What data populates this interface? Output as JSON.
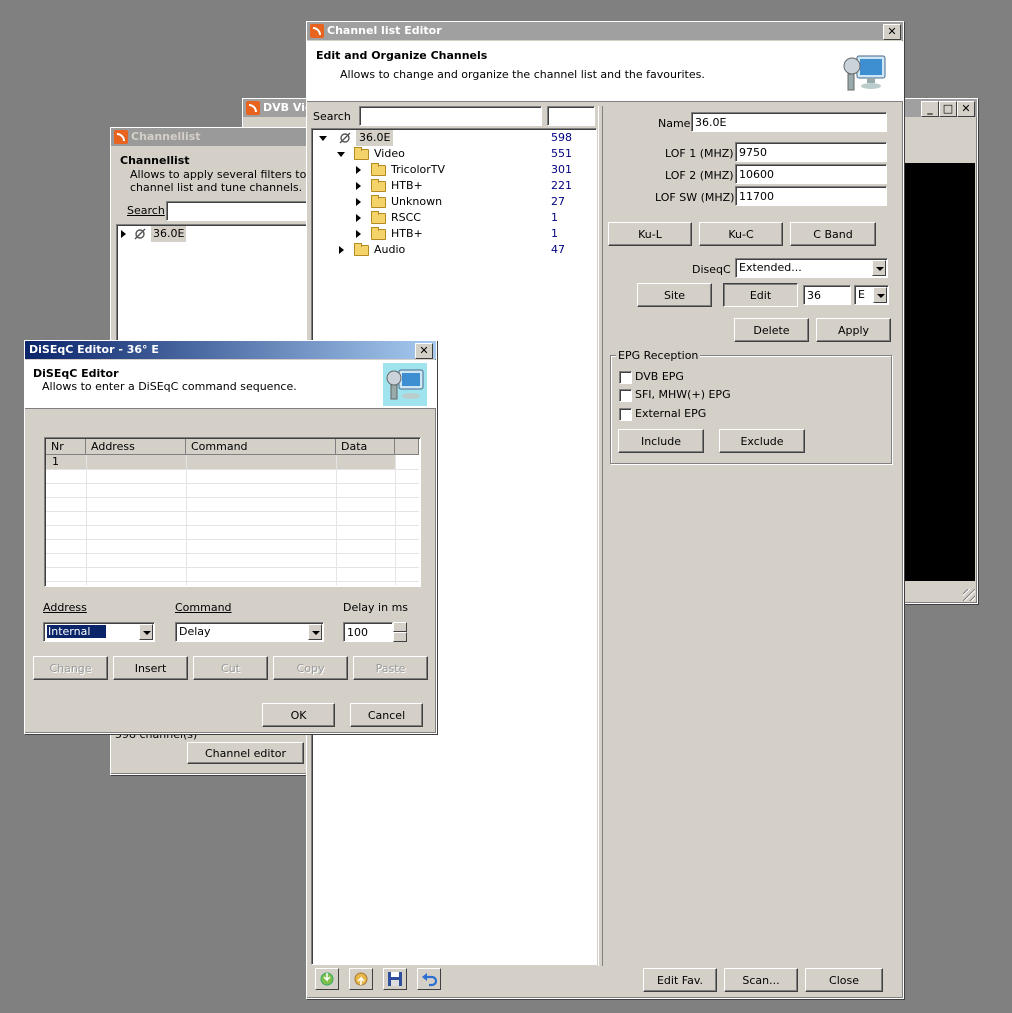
{
  "dvb_window": {
    "title": "DVB Vie"
  },
  "channellist_window": {
    "title": "Channellist",
    "header_title": "Channellist",
    "header_sub_line1": "Allows to apply several filters to the",
    "header_sub_line2": "channel list and tune channels.",
    "search_label": "Search",
    "search_value": "",
    "tree_root": "36.0E",
    "channels_text": "598 channel(s)",
    "channel_editor_button": "Channel editor"
  },
  "editor_window": {
    "title": "Channel list Editor",
    "header_title": "Edit and Organize Channels",
    "header_sub": "Allows to change and organize the channel list and the favourites.",
    "search_label": "Search",
    "search_value": "",
    "search_value2": "",
    "tree": [
      {
        "label": "36.0E",
        "count": "598"
      },
      {
        "label": "Video",
        "count": "551"
      },
      {
        "label": "TricolorTV",
        "count": "301"
      },
      {
        "label": "НТВ+",
        "count": "221"
      },
      {
        "label": "Unknown",
        "count": "27"
      },
      {
        "label": "RSCC",
        "count": "1"
      },
      {
        "label": "НТВ+",
        "count": "1"
      },
      {
        "label": "Audio",
        "count": "47"
      }
    ],
    "props": {
      "name_label": "Name",
      "name_value": "36.0E",
      "lof1_label": "LOF 1 (MHZ)",
      "lof1_value": "9750",
      "lof2_label": "LOF 2 (MHZ)",
      "lof2_value": "10600",
      "lofsw_label": "LOF SW (MHZ)",
      "lofsw_value": "11700",
      "kul_button": "Ku-L",
      "kuc_button": "Ku-C",
      "cband_button": "C Band",
      "diseqc_label": "DiseqC",
      "diseqc_value": "Extended...",
      "site_button": "Site",
      "edit_button": "Edit",
      "position_value": "36",
      "direction_value": "E",
      "delete_button": "Delete",
      "apply_button": "Apply",
      "epg_group_label": "EPG Reception",
      "dvb_epg_label": "DVB EPG",
      "sfi_epg_label": "SFI, MHW(+) EPG",
      "ext_epg_label": "External EPG",
      "include_button": "Include",
      "exclude_button": "Exclude"
    },
    "bottom": {
      "edit_fav_button": "Edit Fav.",
      "scan_button": "Scan...",
      "close_button": "Close"
    }
  },
  "diseqc_window": {
    "title": "DiSEqC Editor - 36° E",
    "header_title": "DiSEqC Editor",
    "header_sub": "Allows to enter a DiSEqC command sequence.",
    "columns": [
      "Nr",
      "Address",
      "Command",
      "Data"
    ],
    "rows": [
      {
        "nr": "1",
        "address": "",
        "command": "",
        "data": ""
      }
    ],
    "address_label": "Address",
    "address_value": "Internal",
    "command_label": "Command",
    "command_value": "Delay",
    "delay_label": "Delay in ms",
    "delay_value": "100",
    "change_button": "Change",
    "insert_button": "Insert",
    "cut_button": "Cut",
    "copy_button": "Copy",
    "paste_button": "Paste",
    "ok_button": "OK",
    "cancel_button": "Cancel"
  },
  "colors": {
    "desktop": "#808080",
    "face": "#d4d0c8",
    "active_title_start": "#0a246a",
    "active_title_end": "#a6caf0",
    "count_text": "#000080",
    "selection": "#0a246a"
  }
}
